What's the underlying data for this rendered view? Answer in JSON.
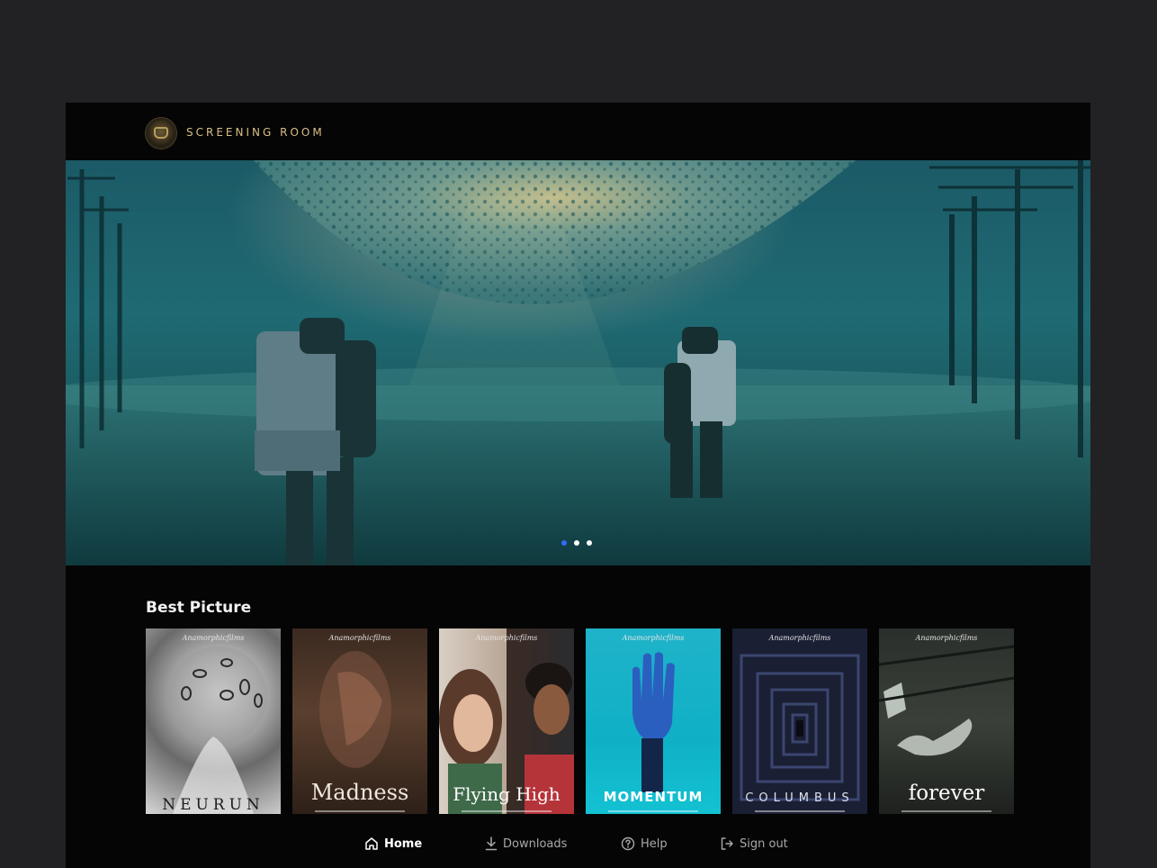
{
  "brand": {
    "name": "SCREENING ROOM",
    "logo_icon": "studio-emblem-icon"
  },
  "hero": {
    "slides_count": 3,
    "active_index": 0
  },
  "section": {
    "title": "Best Picture"
  },
  "posters": [
    {
      "studio": "Anamorphicfilms",
      "title": "NEURUN"
    },
    {
      "studio": "Anamorphicfilms",
      "title": "Madness"
    },
    {
      "studio": "Anamorphicfilms",
      "title": "Flying High"
    },
    {
      "studio": "Anamorphicfilms",
      "title": "MOMENTUM"
    },
    {
      "studio": "Anamorphicfilms",
      "title": "COLUMBUS"
    },
    {
      "studio": "Anamorphicfilms",
      "title": "forever"
    }
  ],
  "nav": {
    "home": "Home",
    "downloads": "Downloads",
    "help": "Help",
    "signout": "Sign out"
  },
  "colors": {
    "accent": "#2f6bff",
    "brand_gold": "#d9bf86",
    "background": "#050505"
  }
}
